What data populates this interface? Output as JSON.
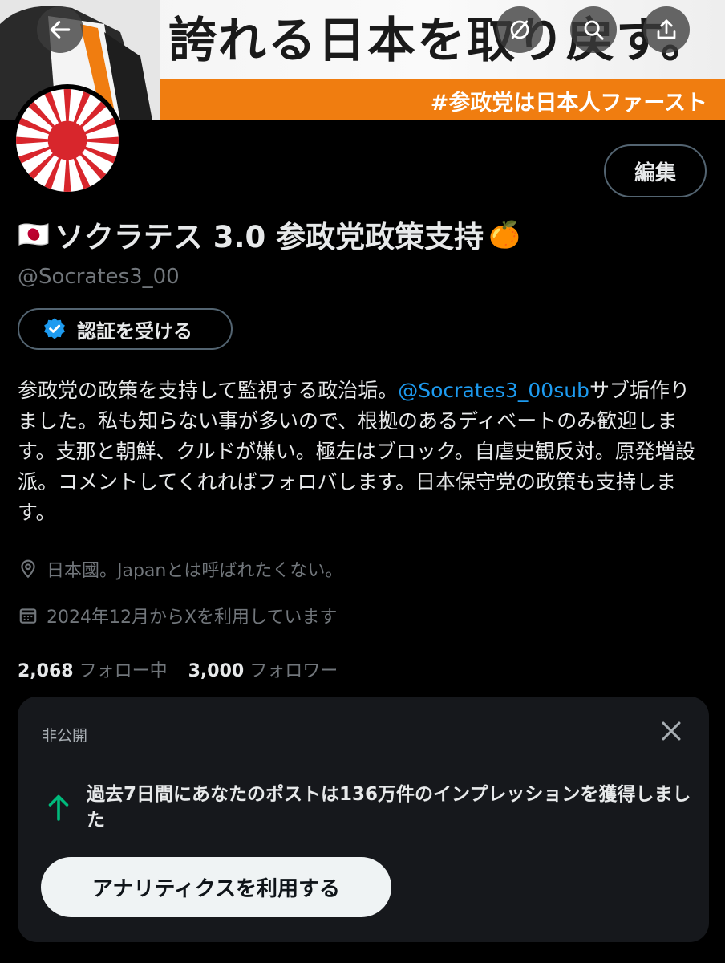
{
  "banner": {
    "title": "誇れる日本を取り戻す。",
    "hashtag": "#参政党は日本人ファースト"
  },
  "header": {
    "back_icon": "arrow-left-icon",
    "grok_icon": "grok-icon",
    "search_icon": "search-icon",
    "share_icon": "share-icon"
  },
  "profile": {
    "edit_label": "編集",
    "flag_emoji": "🇯🇵",
    "display_name": "ソクラテス 3.0 参政党政策支持",
    "name_emoji": "🍊",
    "handle": "@Socrates3_00",
    "verify_label": "認証を受ける",
    "bio_part1": "参政党の政策を支持して監視する政治垢。",
    "bio_mention": "@Socrates3_00sub",
    "bio_part2": "サブ垢作りました。私も知らない事が多いので、根拠のあるディベートのみ歓迎します。支那と朝鮮、クルドが嫌い。極左はブロック。自虐史観反対。原発増設派。コメントしてくれればフォロバします。日本保守党の政策も支持します。",
    "location": "日本國。Japanとは呼ばれたくない。",
    "joined": "2024年12月からXを利用しています",
    "following_count": "2,068",
    "following_label": "フォロー中",
    "followers_count": "3,000",
    "followers_label": "フォロワー"
  },
  "impressions_card": {
    "tag": "非公開",
    "message": "過去7日間にあなたのポストは136万件のインプレッションを獲得しました",
    "button_label": "アナリティクスを利用する"
  },
  "colors": {
    "background": "#000000",
    "accent": "#1d9bf0",
    "banner_orange": "#f07d10",
    "up_arrow": "#00ba7c",
    "flag_red": "#d8262c"
  }
}
